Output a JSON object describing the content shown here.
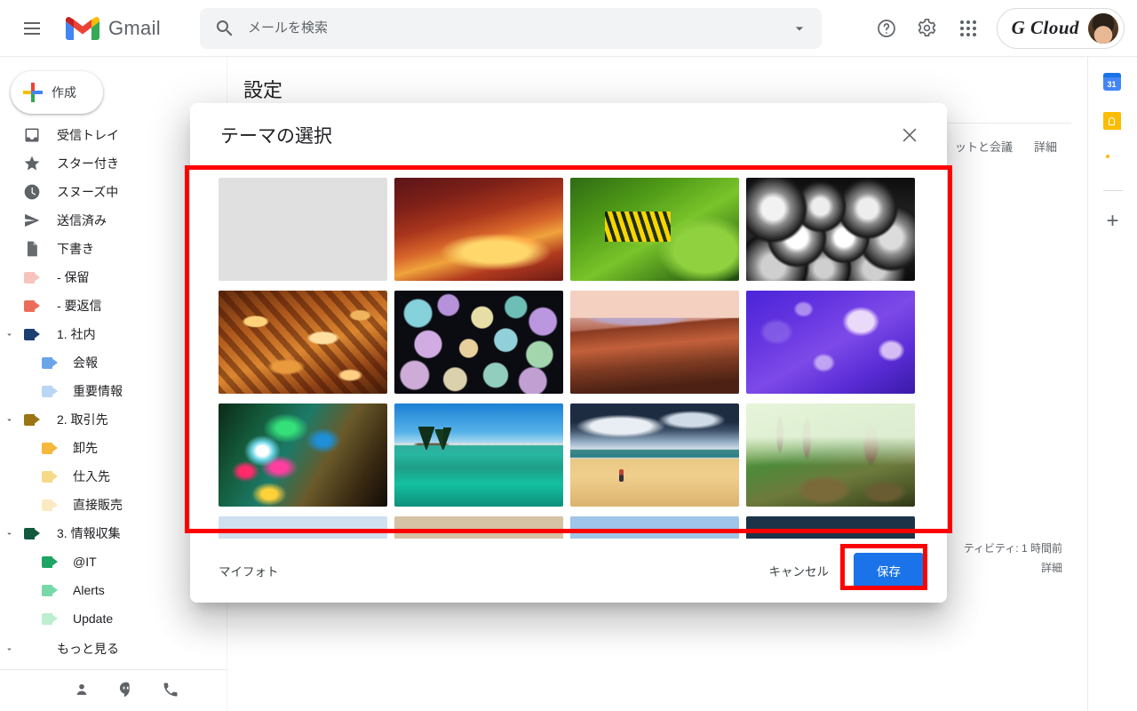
{
  "app": {
    "brand": "Gmail",
    "account_name": "G Cloud"
  },
  "topbar": {
    "menu_icon": "hamburger-icon",
    "logo_icon": "gmail-logo-icon",
    "search": {
      "icon": "search-icon",
      "placeholder": "メールを検索",
      "value": "",
      "options_icon": "chevron-down-icon"
    },
    "help_icon": "help-icon",
    "settings_icon": "gear-icon",
    "apps_icon": "apps-grid-icon",
    "avatar_icon": "avatar-icon"
  },
  "sidebar": {
    "compose": {
      "label": "作成",
      "icon": "plus-icon"
    },
    "items": [
      {
        "label": "受信トレイ",
        "icon": "inbox-icon",
        "level": 0,
        "color": "#5f6368",
        "type": "icon"
      },
      {
        "label": "スター付き",
        "icon": "star-icon",
        "level": 0,
        "color": "#5f6368",
        "type": "icon"
      },
      {
        "label": "スヌーズ中",
        "icon": "clock-icon",
        "level": 0,
        "color": "#5f6368",
        "type": "icon"
      },
      {
        "label": "送信済み",
        "icon": "send-icon",
        "level": 0,
        "color": "#5f6368",
        "type": "icon"
      },
      {
        "label": "下書き",
        "icon": "draft-icon",
        "level": 0,
        "color": "#5f6368",
        "type": "icon"
      },
      {
        "label": "- 保留",
        "icon": "label-icon",
        "level": 0,
        "color": "#f7c4bd",
        "type": "tag"
      },
      {
        "label": "- 要返信",
        "icon": "label-icon",
        "level": 0,
        "color": "#ec6c5a",
        "type": "tag"
      },
      {
        "label": "1. 社内",
        "icon": "label-icon",
        "level": 0,
        "color": "#1b3f70",
        "type": "tag",
        "expanded": true
      },
      {
        "label": "会報",
        "icon": "label-icon",
        "level": 1,
        "color": "#6aa5e8",
        "type": "tag"
      },
      {
        "label": "重要情報",
        "icon": "label-icon",
        "level": 1,
        "color": "#b9d6f5",
        "type": "tag"
      },
      {
        "label": "2. 取引先",
        "icon": "label-icon",
        "level": 0,
        "color": "#9a7514",
        "type": "tag",
        "expanded": true
      },
      {
        "label": "卸先",
        "icon": "label-icon",
        "level": 1,
        "color": "#f5b83d",
        "type": "tag"
      },
      {
        "label": "仕入先",
        "icon": "label-icon",
        "level": 1,
        "color": "#f7d98a",
        "type": "tag"
      },
      {
        "label": "直接販売",
        "icon": "label-icon",
        "level": 1,
        "color": "#fbeac2",
        "type": "tag"
      },
      {
        "label": "3. 情報収集",
        "icon": "label-icon",
        "level": 0,
        "color": "#10593d",
        "type": "tag",
        "expanded": true
      },
      {
        "label": "@IT",
        "icon": "label-icon",
        "level": 1,
        "color": "#1ea463",
        "type": "tag"
      },
      {
        "label": "Alerts",
        "icon": "label-icon",
        "level": 1,
        "color": "#77d9a8",
        "type": "tag"
      },
      {
        "label": "Update",
        "icon": "label-icon",
        "level": 1,
        "color": "#bdeed0",
        "type": "tag"
      }
    ],
    "more": {
      "label": "もっと見る",
      "icon": "chevron-down-icon"
    },
    "footer_icons": [
      "contacts-icon",
      "hangouts-icon",
      "phone-icon"
    ]
  },
  "main": {
    "page_title": "設定",
    "tabs": [
      {
        "label": "ットと会議"
      },
      {
        "label": "詳細"
      }
    ],
    "activity": {
      "text": "ティビティ: 1 時間前",
      "link": "詳細"
    }
  },
  "right_rail": {
    "items": [
      {
        "name": "calendar-icon",
        "badge": "31"
      },
      {
        "name": "keep-icon"
      },
      {
        "name": "tasks-icon"
      }
    ],
    "add_label": "+",
    "expand_icon": "chevron-right-icon"
  },
  "dialog": {
    "title": "テーマの選択",
    "close_icon": "close-icon",
    "footer": {
      "my_photos": "マイフォト",
      "cancel": "キャンセル",
      "save": "保存"
    },
    "themes": [
      {
        "name": "chess",
        "art": "art-chess",
        "row": 1
      },
      {
        "name": "canyon",
        "art": "art-canyon",
        "row": 1
      },
      {
        "name": "caterpillar",
        "art": "art-cater",
        "row": 1
      },
      {
        "name": "pipes",
        "art": "art-pipes",
        "row": 1
      },
      {
        "name": "autumn-leaves",
        "art": "art-leaves",
        "row": 2
      },
      {
        "name": "bokeh-lights",
        "art": "art-bokeh",
        "row": 2
      },
      {
        "name": "horseshoe-bend",
        "art": "art-bend",
        "row": 2
      },
      {
        "name": "jellyfish",
        "art": "art-jelly",
        "row": 2
      },
      {
        "name": "neon-swirl",
        "art": "art-neon",
        "row": 3
      },
      {
        "name": "lake-tahoe",
        "art": "art-tahoe",
        "row": 3
      },
      {
        "name": "storm-beach",
        "art": "art-storm",
        "row": 3
      },
      {
        "name": "forest-stream",
        "art": "art-forest",
        "row": 3
      },
      {
        "name": "partial-1",
        "art": "art-p1",
        "row": 4
      },
      {
        "name": "partial-2",
        "art": "art-p2",
        "row": 4
      },
      {
        "name": "partial-3",
        "art": "art-p3",
        "row": 4
      },
      {
        "name": "partial-4",
        "art": "art-p4",
        "row": 4
      }
    ]
  },
  "annotations": {
    "highlight_color": "#ff0000",
    "boxes": [
      "theme-grid",
      "save-button"
    ]
  }
}
